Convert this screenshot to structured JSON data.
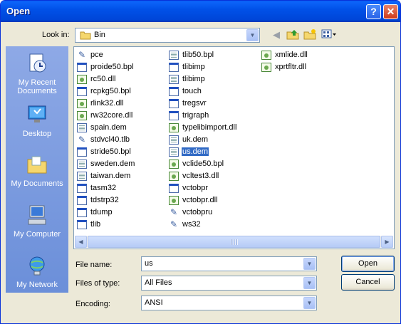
{
  "window": {
    "title": "Open",
    "help_label": "?",
    "close_label": "✕"
  },
  "look_in": {
    "label": "Look in:",
    "value": "Bin",
    "icons": [
      "folder-icon",
      "back-icon",
      "up-folder-icon",
      "new-folder-icon",
      "view-menu-icon"
    ]
  },
  "places": [
    {
      "name": "My Recent Documents",
      "icon": "recent-documents-icon"
    },
    {
      "name": "Desktop",
      "icon": "desktop-icon"
    },
    {
      "name": "My Documents",
      "icon": "my-documents-icon"
    },
    {
      "name": "My Computer",
      "icon": "my-computer-icon"
    },
    {
      "name": "My Network",
      "icon": "my-network-icon"
    }
  ],
  "files": {
    "column1": [
      {
        "name": "pce",
        "icon": "app"
      },
      {
        "name": "proide50.bpl",
        "icon": "win"
      },
      {
        "name": "rc50.dll",
        "icon": "dll"
      },
      {
        "name": "rcpkg50.bpl",
        "icon": "win"
      },
      {
        "name": "rlink32.dll",
        "icon": "dll"
      },
      {
        "name": "rw32core.dll",
        "icon": "dll"
      },
      {
        "name": "spain.dem",
        "icon": "doc"
      },
      {
        "name": "stdvcl40.tlb",
        "icon": "app"
      },
      {
        "name": "stride50.bpl",
        "icon": "win"
      },
      {
        "name": "sweden.dem",
        "icon": "doc"
      },
      {
        "name": "taiwan.dem",
        "icon": "doc"
      },
      {
        "name": "tasm32",
        "icon": "win"
      },
      {
        "name": "tdstrp32",
        "icon": "win"
      },
      {
        "name": "tdump",
        "icon": "win"
      },
      {
        "name": "tlib",
        "icon": "win"
      }
    ],
    "column2": [
      {
        "name": "tlib50.bpl",
        "icon": "doc"
      },
      {
        "name": "tlibimp",
        "icon": "win"
      },
      {
        "name": "tlibimp",
        "icon": "doc"
      },
      {
        "name": "touch",
        "icon": "win"
      },
      {
        "name": "tregsvr",
        "icon": "win"
      },
      {
        "name": "trigraph",
        "icon": "win"
      },
      {
        "name": "typelibimport.dll",
        "icon": "dll"
      },
      {
        "name": "uk.dem",
        "icon": "doc"
      },
      {
        "name": "us.dem",
        "icon": "doc",
        "selected": true
      },
      {
        "name": "vclide50.bpl",
        "icon": "dll"
      },
      {
        "name": "vcltest3.dll",
        "icon": "dll"
      },
      {
        "name": "vctobpr",
        "icon": "win"
      },
      {
        "name": "vctobpr.dll",
        "icon": "dll"
      },
      {
        "name": "vctobpru",
        "icon": "app"
      },
      {
        "name": "ws32",
        "icon": "app"
      }
    ],
    "column3": [
      {
        "name": "xmlide.dll",
        "icon": "dll"
      },
      {
        "name": "xprtfltr.dll",
        "icon": "dll"
      }
    ]
  },
  "fields": {
    "file_name_label": "File name:",
    "file_name_value": "us",
    "files_of_type_label": "Files of type:",
    "files_of_type_value": "All Files",
    "encoding_label": "Encoding:",
    "encoding_value": "ANSI"
  },
  "buttons": {
    "open": "Open",
    "cancel": "Cancel"
  },
  "colors": {
    "title_bar": "#0151e8",
    "places_bar": "#7b9ee0",
    "selection": "#316ac5",
    "dialog_bg": "#ece9d8"
  }
}
